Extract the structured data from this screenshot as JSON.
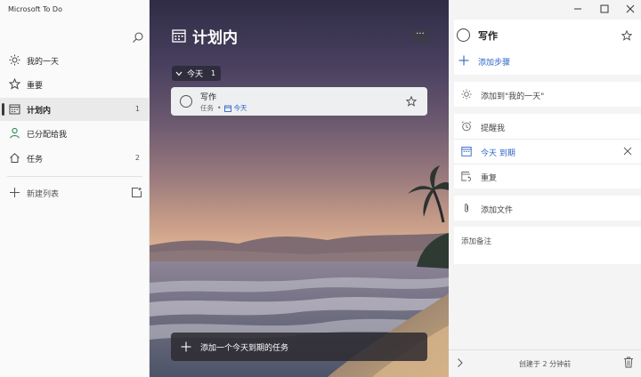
{
  "app": {
    "title": "Microsoft To Do"
  },
  "sidebar": {
    "items": [
      {
        "label": "我的一天",
        "count": ""
      },
      {
        "label": "重要",
        "count": ""
      },
      {
        "label": "计划内",
        "count": "1"
      },
      {
        "label": "已分配给我",
        "count": ""
      },
      {
        "label": "任务",
        "count": "2"
      }
    ],
    "new_list": "新建列表"
  },
  "main": {
    "title": "计划内",
    "more": "···",
    "group": {
      "label": "今天",
      "count": "1"
    },
    "task": {
      "title": "写作",
      "list": "任务",
      "separator": "•",
      "due": "今天"
    },
    "add_task_placeholder": "添加一个今天到期的任务"
  },
  "detail": {
    "title": "写作",
    "add_step": "添加步骤",
    "add_to_my_day": "添加到\"我的一天\"",
    "remind": "提醒我",
    "due": "今天 到期",
    "repeat": "重复",
    "add_file": "添加文件",
    "add_note": "添加备注",
    "created": "创建于 2 分钟前"
  },
  "colors": {
    "accent": "#2e64c7",
    "sidebar_bg": "#fafafa",
    "detail_bg": "#f4f4f4"
  }
}
